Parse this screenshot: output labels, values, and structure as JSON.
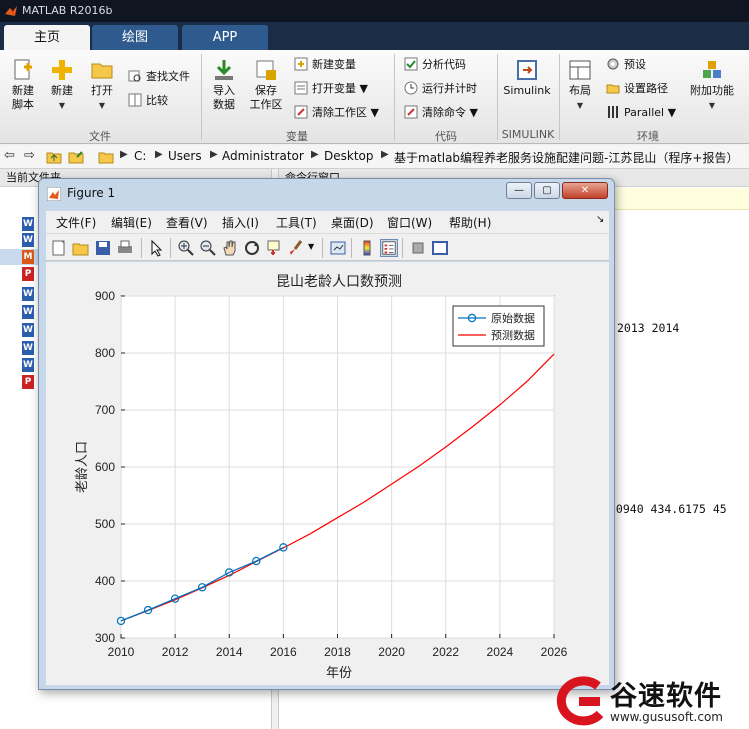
{
  "app": {
    "title": "MATLAB R2016b",
    "tabs": [
      "主页",
      "绘图",
      "APP"
    ]
  },
  "ribbon": {
    "file": {
      "new_script": "新建\n脚本",
      "new": "新建",
      "open": "打开",
      "find_files": "查找文件",
      "compare": "比较",
      "group": "文件"
    },
    "variable": {
      "import": "导入\n数据",
      "save_ws": "保存\n工作区",
      "new_var": "新建变量",
      "open_var": "打开变量",
      "clear_ws": "清除工作区",
      "group": "变量"
    },
    "code": {
      "analyze": "分析代码",
      "run_time": "运行并计时",
      "clear_cmd": "清除命令",
      "group": "代码"
    },
    "simulink": {
      "simulink": "Simulink",
      "group": "SIMULINK"
    },
    "env": {
      "layout": "布局",
      "prefs": "预设",
      "set_path": "设置路径",
      "parallel": "Parallel",
      "addons": "附加功能",
      "group": "环境"
    }
  },
  "address": {
    "crumbs": [
      "C:",
      "Users",
      "Administrator",
      "Desktop",
      "基于matlab编程养老服务设施配建问题-江苏昆山（程序+报告）"
    ]
  },
  "left_panel": {
    "title": "当前文件夹"
  },
  "right_panel": {
    "title": "命令行窗口",
    "lines": [
      {
        "text": "2013        2014"
      },
      {
        "text": ".0940  434.6175  45"
      }
    ]
  },
  "figure": {
    "title": "Figure 1",
    "menu": [
      "文件(F)",
      "编辑(E)",
      "查看(V)",
      "插入(I)",
      "工具(T)",
      "桌面(D)",
      "窗口(W)",
      "帮助(H)"
    ]
  },
  "chart_data": {
    "type": "line",
    "title": "昆山老龄人口数预测",
    "xlabel": "年份",
    "ylabel": "老龄人口",
    "xlim": [
      2010,
      2026
    ],
    "ylim": [
      300,
      900
    ],
    "xticks": [
      "2010",
      "2012",
      "2014",
      "2016",
      "2018",
      "2020",
      "2022",
      "2024",
      "2026"
    ],
    "yticks": [
      "300",
      "400",
      "500",
      "600",
      "700",
      "800",
      "900"
    ],
    "grid": true,
    "legend_position": "top-right",
    "series": [
      {
        "name": "原始数据",
        "style": "line-with-circle-markers",
        "color": "#0072bd",
        "x": [
          2010,
          2011,
          2012,
          2013,
          2014,
          2015,
          2016
        ],
        "y": [
          330,
          349,
          369,
          389,
          415,
          435,
          459
        ]
      },
      {
        "name": "预测数据",
        "style": "line",
        "color": "#ff0000",
        "x": [
          2010,
          2011,
          2012,
          2013,
          2014,
          2015,
          2016,
          2017,
          2018,
          2019,
          2020,
          2021,
          2022,
          2023,
          2024,
          2025,
          2026
        ],
        "y": [
          330,
          348,
          367,
          388,
          410,
          434,
          458,
          483,
          511,
          539,
          570,
          601,
          635,
          671,
          709,
          750,
          798
        ]
      }
    ]
  },
  "watermark": {
    "brand": "谷速软件",
    "url": "www.gususoft.com"
  }
}
